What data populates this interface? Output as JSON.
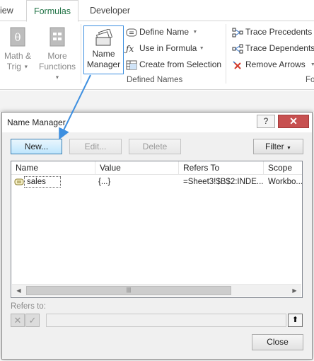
{
  "ribbon": {
    "tabs": [
      {
        "label": "View"
      },
      {
        "label": "Formulas"
      },
      {
        "label": "Developer"
      }
    ],
    "visible_tab_view": "iew",
    "math_trig": {
      "line1": "Math &",
      "line2": "Trig"
    },
    "more_functions": {
      "line1": "More",
      "line2": "Functions"
    },
    "name_manager": {
      "line1": "Name",
      "line2": "Manager"
    },
    "define_name": "Define Name",
    "use_in_formula": "Use in Formula",
    "create_from_selection": "Create from Selection",
    "defined_names_group": "Defined Names",
    "trace_precedents": "Trace Precedents",
    "trace_dependents": "Trace Dependents",
    "remove_arrows": "Remove Arrows",
    "formula_auditing_cut": "Fo"
  },
  "dialog": {
    "title": "Name Manager",
    "help": "?",
    "close": "✕",
    "new_label": "New...",
    "edit_label": "Edit...",
    "delete_label": "Delete",
    "filter_label": "Filter",
    "columns": [
      "Name",
      "Value",
      "Refers To",
      "Scope"
    ],
    "rows": [
      {
        "name": "sales",
        "value": "{...}",
        "refers_to": "=Sheet3!$B$2:INDE...",
        "scope": "Workbo..."
      }
    ],
    "refers_to_label": "Refers to:",
    "close_label": "Close"
  },
  "colors": {
    "accent_tab": "#217346",
    "highlight": "#3d8fe0",
    "close_red": "#c75050"
  }
}
